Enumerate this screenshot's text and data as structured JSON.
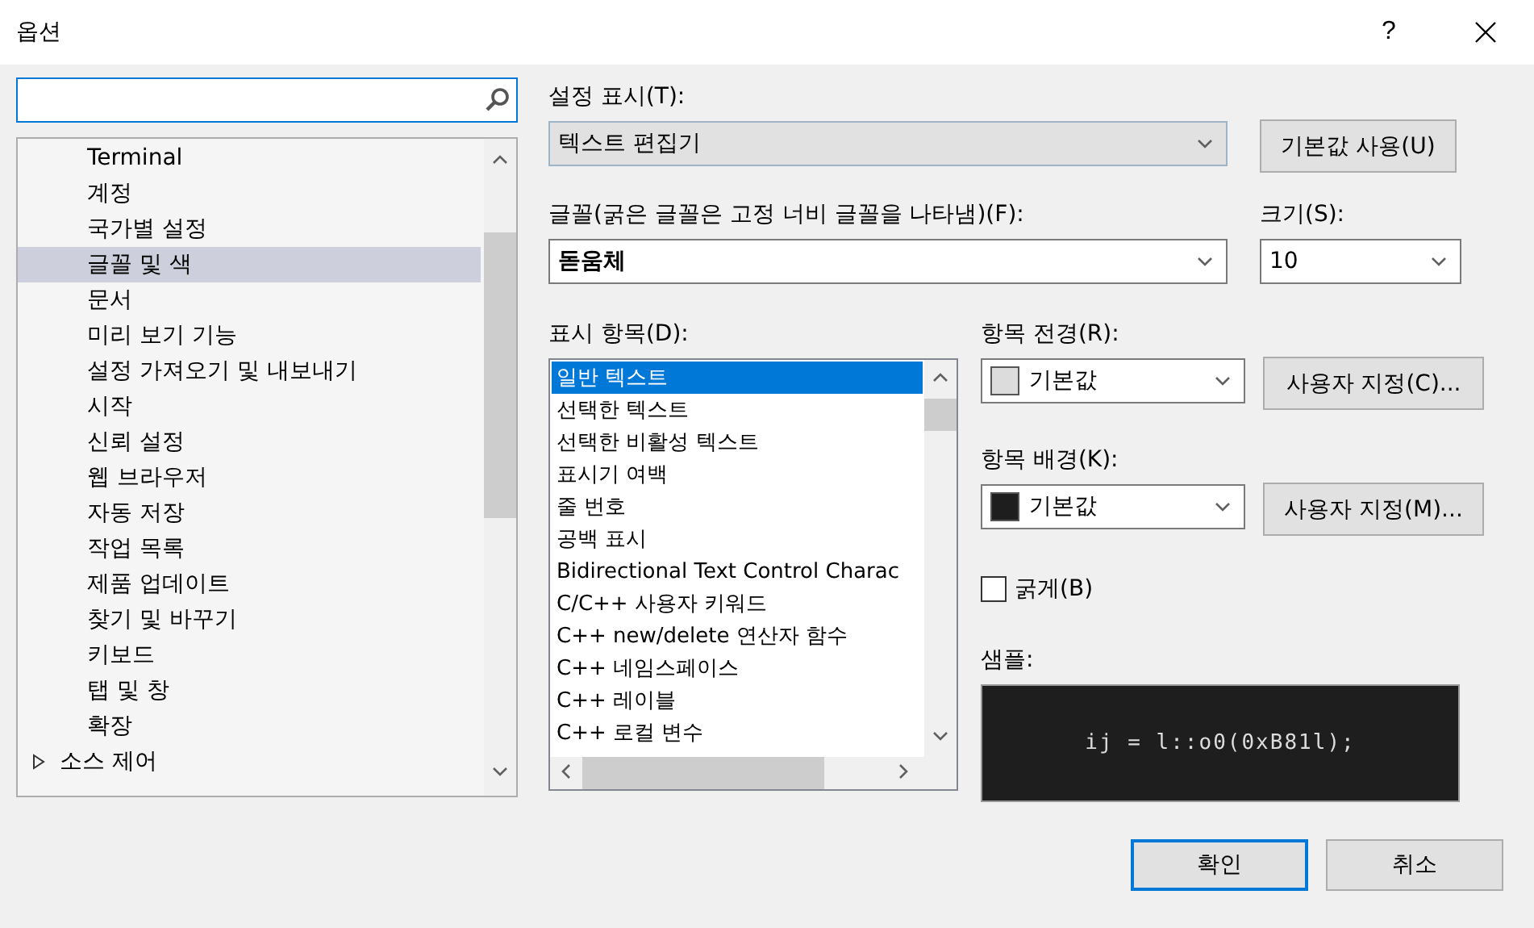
{
  "window": {
    "title": "옵션",
    "help": "?"
  },
  "tree": {
    "items": [
      {
        "children": [
          {
            "label": "Terminal",
            "selected": false
          },
          {
            "label": "계정",
            "selected": false
          },
          {
            "label": "국가별 설정",
            "selected": false
          },
          {
            "label": "글꼴 및 색",
            "selected": true
          },
          {
            "label": "문서",
            "selected": false
          },
          {
            "label": "미리 보기 기능",
            "selected": false
          },
          {
            "label": "설정 가져오기 및 내보내기",
            "selected": false
          },
          {
            "label": "시작",
            "selected": false
          },
          {
            "label": "신뢰 설정",
            "selected": false
          },
          {
            "label": "웹 브라우저",
            "selected": false
          },
          {
            "label": "자동 저장",
            "selected": false
          },
          {
            "label": "작업 목록",
            "selected": false
          },
          {
            "label": "제품 업데이트",
            "selected": false
          },
          {
            "label": "찾기 및 바꾸기",
            "selected": false
          },
          {
            "label": "키보드",
            "selected": false
          },
          {
            "label": "탭 및 창",
            "selected": false
          },
          {
            "label": "확장",
            "selected": false
          }
        ]
      },
      {
        "label": "소스 제어",
        "selected": false,
        "expanded": false
      }
    ]
  },
  "show_settings": {
    "label": "설정 표시(T):",
    "value": "텍스트 편집기",
    "button": "기본값 사용(U)"
  },
  "font": {
    "label": "글꼴(굵은 글꼴은 고정 너비 글꼴을 나타냄)(F):",
    "value": "돋움체"
  },
  "size": {
    "label": "크기(S):",
    "value": "10"
  },
  "display_items": {
    "label": "표시 항목(D):",
    "items": [
      {
        "label": "일반 텍스트",
        "selected": true
      },
      {
        "label": "선택한 텍스트",
        "selected": false
      },
      {
        "label": "선택한 비활성 텍스트",
        "selected": false
      },
      {
        "label": "표시기 여백",
        "selected": false
      },
      {
        "label": "줄 번호",
        "selected": false
      },
      {
        "label": "공백 표시",
        "selected": false
      },
      {
        "label": "Bidirectional Text Control Charac",
        "selected": false
      },
      {
        "label": "C/C++ 사용자 키워드",
        "selected": false
      },
      {
        "label": "C++ new/delete 연산자 함수",
        "selected": false
      },
      {
        "label": "C++ 네임스페이스",
        "selected": false
      },
      {
        "label": "C++ 레이블",
        "selected": false
      },
      {
        "label": "C++ 로컬 변수",
        "selected": false
      }
    ]
  },
  "foreground": {
    "label": "항목 전경(R):",
    "value": "기본값",
    "color": "#dcdcdc",
    "button": "사용자 지정(C)..."
  },
  "background": {
    "label": "항목 배경(K):",
    "value": "기본값",
    "color": "#1e1e1e",
    "button": "사용자 지정(M)..."
  },
  "bold": {
    "label": "굵게(B)",
    "checked": false
  },
  "sample": {
    "label": "샘플:",
    "text": "ij = l::o0(0xB81l);"
  },
  "buttons": [
    "확인",
    "취소"
  ]
}
